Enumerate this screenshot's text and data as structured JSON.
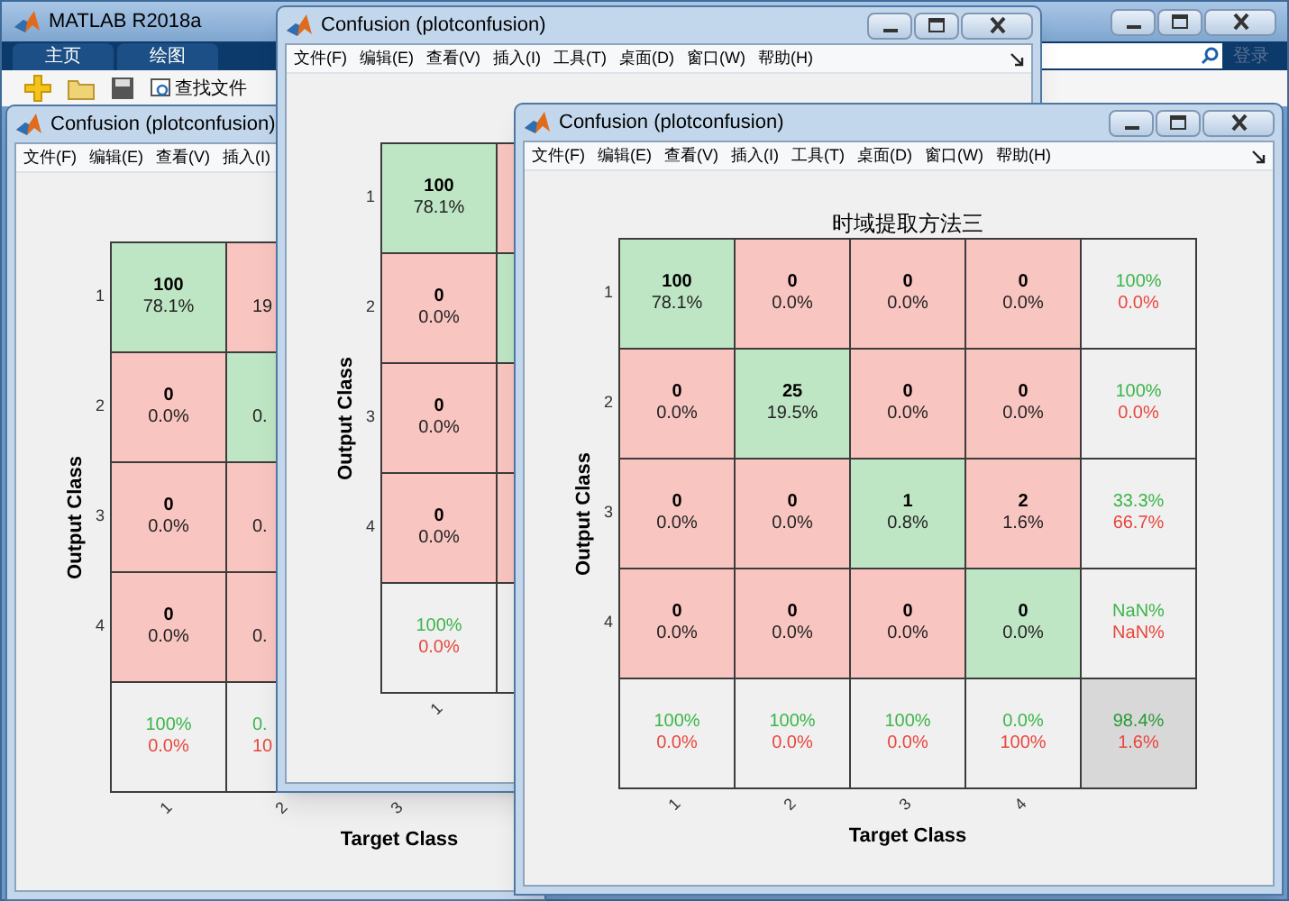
{
  "main_window": {
    "title": "MATLAB R2018a",
    "tabs": [
      "主页",
      "绘图"
    ],
    "toolbar": [
      {
        "kind": "new"
      },
      {
        "kind": "open"
      },
      {
        "kind": "save"
      },
      {
        "kind": "find",
        "label": "查找文件"
      }
    ],
    "sign_in": "登录"
  },
  "figures": [
    {
      "title": "Confusion (plotconfusion)",
      "menu": [
        "文件(F)",
        "编辑(E)",
        "查看(V)",
        "插入(I)"
      ],
      "plot": {
        "y_label": "Output Class",
        "x_label": "Target Class",
        "row_ticks": [
          "1",
          "2",
          "3",
          "4"
        ],
        "col_ticks": [
          "1",
          "2",
          "3"
        ],
        "rows": [
          [
            {
              "kind": "correct",
              "count": "100",
              "percent": "78.1%"
            },
            {
              "kind": "wrong",
              "percent": "19"
            }
          ],
          [
            {
              "kind": "wrong",
              "count": "0",
              "percent": "0.0%"
            },
            {
              "kind": "correct",
              "percent": "0."
            }
          ],
          [
            {
              "kind": "wrong",
              "count": "0",
              "percent": "0.0%"
            },
            {
              "kind": "wrong",
              "percent": "0."
            }
          ],
          [
            {
              "kind": "wrong",
              "count": "0",
              "percent": "0.0%"
            },
            {
              "kind": "wrong",
              "percent": "0."
            }
          ],
          [
            {
              "kind": "summary",
              "good": "100%",
              "bad": "0.0%"
            },
            {
              "kind": "summary",
              "good": "0.",
              "bad": "10"
            }
          ]
        ]
      }
    },
    {
      "title": "Confusion (plotconfusion)",
      "menu": [
        "文件(F)",
        "编辑(E)",
        "查看(V)",
        "插入(I)",
        "工具(T)",
        "桌面(D)",
        "窗口(W)",
        "帮助(H)"
      ],
      "plot": {
        "y_label": "Output Class",
        "row_ticks": [
          "1",
          "2",
          "3",
          "4"
        ],
        "col_ticks": [
          "1"
        ],
        "rows": [
          [
            {
              "kind": "correct",
              "count": "100",
              "percent": "78.1%"
            },
            {
              "kind": "wrong"
            }
          ],
          [
            {
              "kind": "wrong",
              "count": "0",
              "percent": "0.0%"
            },
            {
              "kind": "correct"
            }
          ],
          [
            {
              "kind": "wrong",
              "count": "0",
              "percent": "0.0%"
            },
            {
              "kind": "wrong"
            }
          ],
          [
            {
              "kind": "wrong",
              "count": "0",
              "percent": "0.0%"
            },
            {
              "kind": "wrong"
            }
          ],
          [
            {
              "kind": "summary",
              "good": "100%",
              "bad": "0.0%"
            },
            {
              "kind": "summary"
            }
          ]
        ]
      }
    },
    {
      "title": "Confusion (plotconfusion)",
      "menu": [
        "文件(F)",
        "编辑(E)",
        "查看(V)",
        "插入(I)",
        "工具(T)",
        "桌面(D)",
        "窗口(W)",
        "帮助(H)"
      ],
      "plot": {
        "title": "时域提取方法三",
        "y_label": "Output Class",
        "x_label": "Target Class",
        "row_ticks": [
          "1",
          "2",
          "3",
          "4"
        ],
        "col_ticks": [
          "1",
          "2",
          "3",
          "4"
        ],
        "rows": [
          [
            {
              "kind": "correct",
              "count": "100",
              "percent": "78.1%"
            },
            {
              "kind": "wrong",
              "count": "0",
              "percent": "0.0%"
            },
            {
              "kind": "wrong",
              "count": "0",
              "percent": "0.0%"
            },
            {
              "kind": "wrong",
              "count": "0",
              "percent": "0.0%"
            },
            {
              "kind": "summary",
              "good": "100%",
              "bad": "0.0%"
            }
          ],
          [
            {
              "kind": "wrong",
              "count": "0",
              "percent": "0.0%"
            },
            {
              "kind": "correct",
              "count": "25",
              "percent": "19.5%"
            },
            {
              "kind": "wrong",
              "count": "0",
              "percent": "0.0%"
            },
            {
              "kind": "wrong",
              "count": "0",
              "percent": "0.0%"
            },
            {
              "kind": "summary",
              "good": "100%",
              "bad": "0.0%"
            }
          ],
          [
            {
              "kind": "wrong",
              "count": "0",
              "percent": "0.0%"
            },
            {
              "kind": "wrong",
              "count": "0",
              "percent": "0.0%"
            },
            {
              "kind": "correct",
              "count": "1",
              "percent": "0.8%"
            },
            {
              "kind": "wrong",
              "count": "2",
              "percent": "1.6%"
            },
            {
              "kind": "summary",
              "good": "33.3%",
              "bad": "66.7%"
            }
          ],
          [
            {
              "kind": "wrong",
              "count": "0",
              "percent": "0.0%"
            },
            {
              "kind": "wrong",
              "count": "0",
              "percent": "0.0%"
            },
            {
              "kind": "wrong",
              "count": "0",
              "percent": "0.0%"
            },
            {
              "kind": "correct",
              "count": "0",
              "percent": "0.0%"
            },
            {
              "kind": "summary",
              "good": "NaN%",
              "bad": "NaN%"
            }
          ],
          [
            {
              "kind": "summary",
              "good": "100%",
              "bad": "0.0%"
            },
            {
              "kind": "summary",
              "good": "100%",
              "bad": "0.0%"
            },
            {
              "kind": "summary",
              "good": "100%",
              "bad": "0.0%"
            },
            {
              "kind": "summary",
              "good": "0.0%",
              "bad": "100%"
            },
            {
              "kind": "total",
              "good": "98.4%",
              "bad": "1.6%"
            }
          ]
        ]
      }
    }
  ]
}
